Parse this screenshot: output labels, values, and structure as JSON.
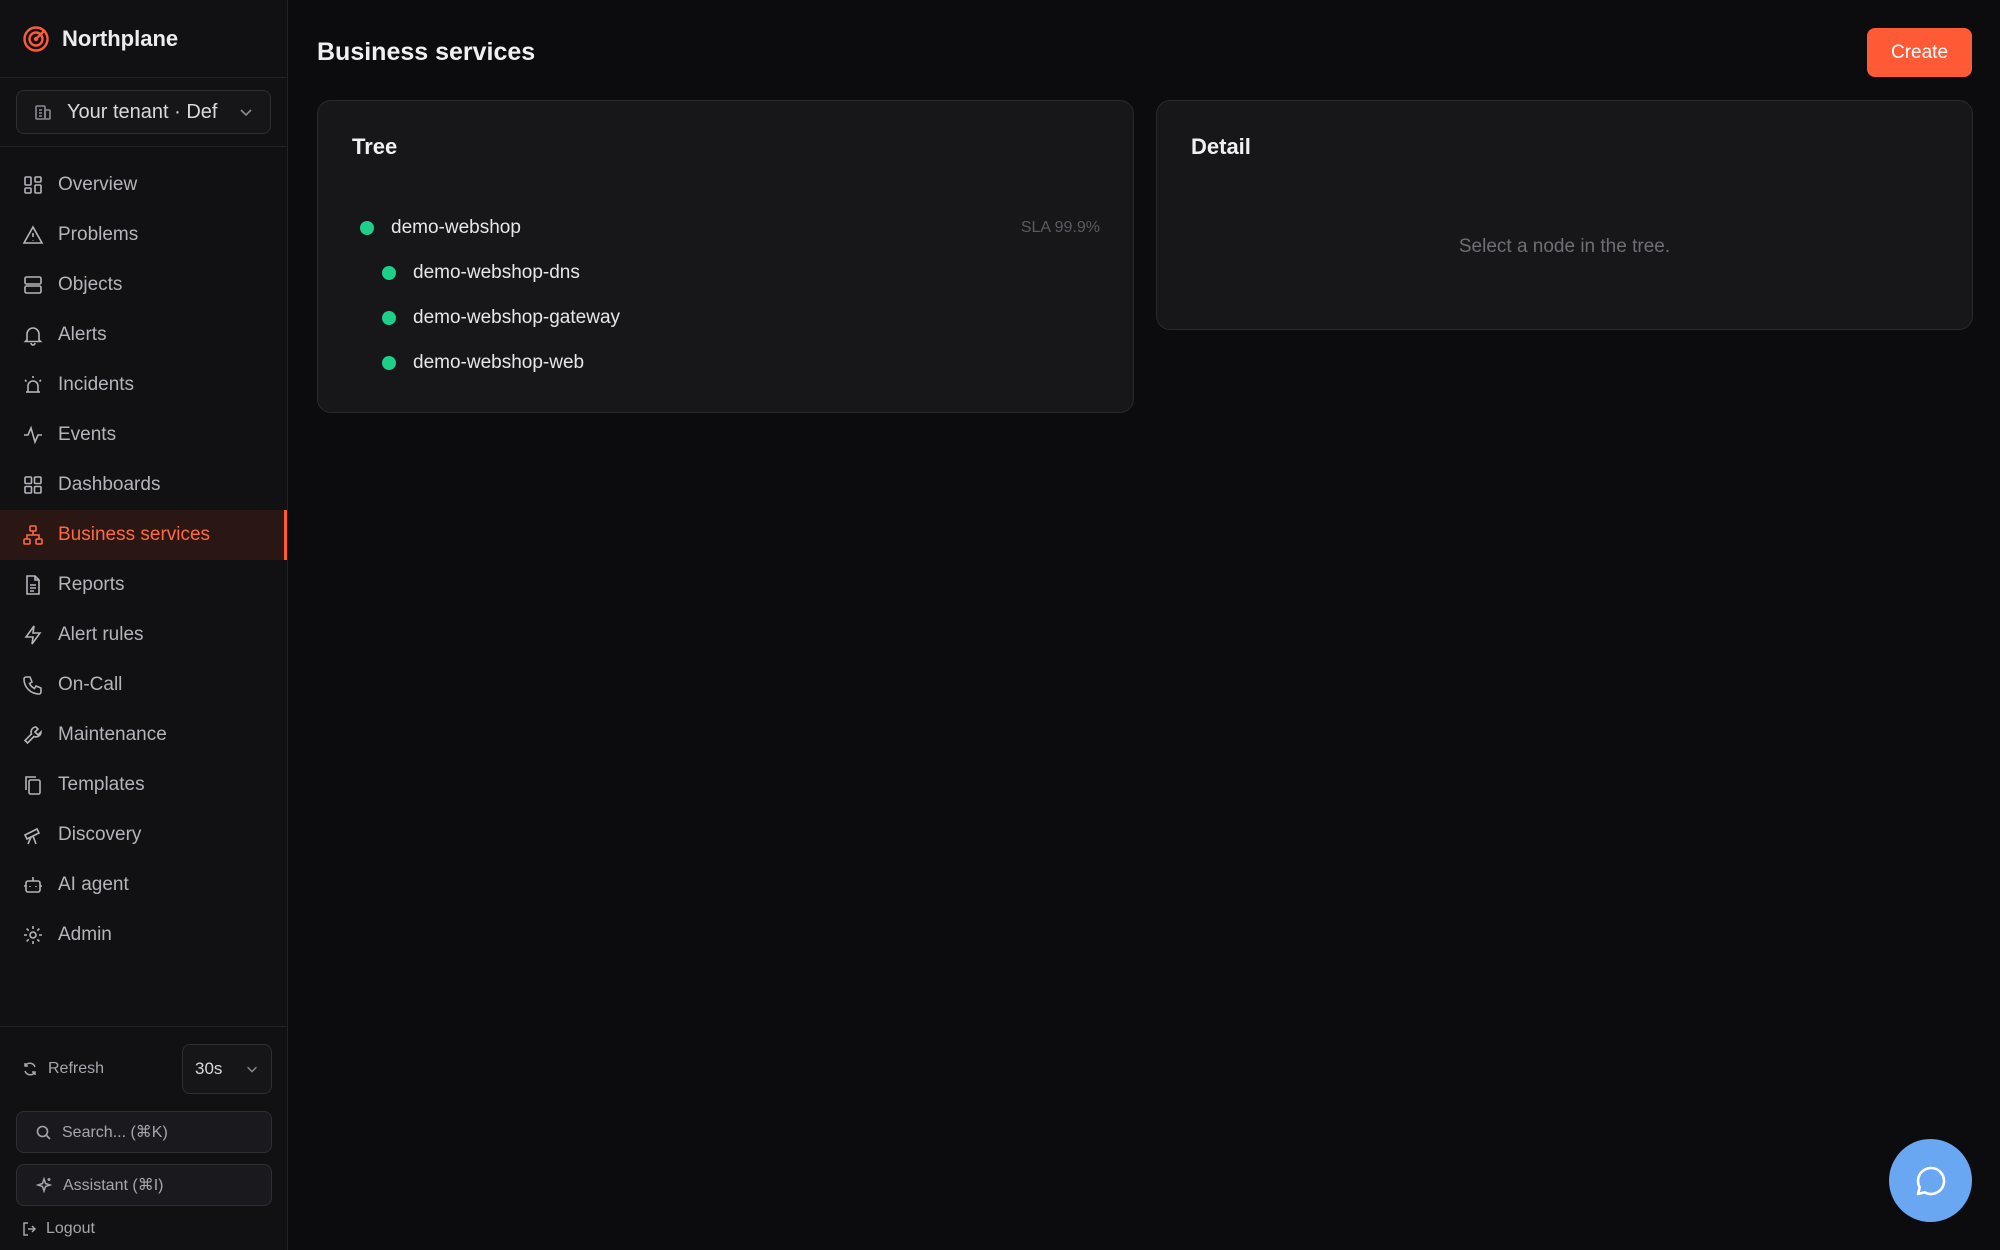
{
  "brand": {
    "name": "Northplane",
    "icon": "target-icon",
    "accent": "#ff5a36"
  },
  "tenant": {
    "label": "Your tenant · Def"
  },
  "nav": [
    {
      "label": "Overview",
      "icon": "dashboard-grid-icon",
      "active": false
    },
    {
      "label": "Problems",
      "icon": "warning-triangle-icon",
      "active": false
    },
    {
      "label": "Objects",
      "icon": "server-icon",
      "active": false
    },
    {
      "label": "Alerts",
      "icon": "bell-icon",
      "active": false
    },
    {
      "label": "Incidents",
      "icon": "siren-icon",
      "active": false
    },
    {
      "label": "Events",
      "icon": "activity-icon",
      "active": false
    },
    {
      "label": "Dashboards",
      "icon": "grid-icon",
      "active": false
    },
    {
      "label": "Business services",
      "icon": "network-icon",
      "active": true
    },
    {
      "label": "Reports",
      "icon": "document-icon",
      "active": false
    },
    {
      "label": "Alert rules",
      "icon": "lightning-icon",
      "active": false
    },
    {
      "label": "On-Call",
      "icon": "phone-icon",
      "active": false
    },
    {
      "label": "Maintenance",
      "icon": "wrench-icon",
      "active": false
    },
    {
      "label": "Templates",
      "icon": "copy-icon",
      "active": false
    },
    {
      "label": "Discovery",
      "icon": "telescope-icon",
      "active": false
    },
    {
      "label": "AI agent",
      "icon": "bot-icon",
      "active": false
    },
    {
      "label": "Admin",
      "icon": "gear-icon",
      "active": false
    }
  ],
  "bottom": {
    "refresh_label": "Refresh",
    "interval": "30s",
    "search_label": "Search... (⌘K)",
    "assistant_label": "Assistant (⌘I)",
    "logout_label": "Logout"
  },
  "page": {
    "title": "Business services",
    "create_label": "Create"
  },
  "tree": {
    "title": "Tree",
    "root": {
      "name": "demo-webshop",
      "sla": "SLA 99.9%",
      "status_color": "#1ecf8a"
    },
    "children": [
      {
        "name": "demo-webshop-dns",
        "status_color": "#1ecf8a"
      },
      {
        "name": "demo-webshop-gateway",
        "status_color": "#1ecf8a"
      },
      {
        "name": "demo-webshop-web",
        "status_color": "#1ecf8a"
      }
    ]
  },
  "detail": {
    "title": "Detail",
    "empty_text": "Select a node in the tree."
  },
  "chat": {
    "icon": "chat-bubble-icon",
    "color": "#6aa7f2"
  }
}
